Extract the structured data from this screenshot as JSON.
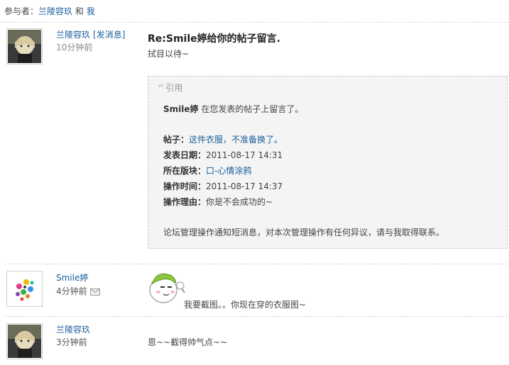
{
  "participants": {
    "label": "参与者：",
    "user1": "兰陵容玖",
    "conj": "和",
    "user2": "我"
  },
  "messages": [
    {
      "author": "兰陵容玖",
      "pm_link": "[发消息]",
      "time": "10分钟前",
      "subject": "Re:Smile婷给你的帖子留言.",
      "body": "拭目以待~",
      "quote": {
        "header": "引用",
        "intro_name": "Smile婷",
        "intro_text": "在您发表的帖子上留言了。",
        "post_label": "帖子：",
        "post_link": "这件衣服，不准备换了。",
        "date_label": "发表日期：",
        "date_value": "2011-08-17 14:31",
        "board_label": "所在版块：",
        "board_link": "口-心情涂鸦",
        "optime_label": "操作时间：",
        "optime_value": "2011-08-17 14:37",
        "reason_label": "操作理由：",
        "reason_value": "你是不会成功的~",
        "notice": "论坛管理操作通知短消息，对本次管理操作有任何异议，请与我取得联系。"
      }
    },
    {
      "author": "Smile婷",
      "time": "4分钟前",
      "body": "我要截图。。你现在穿的衣服图~",
      "icon": "envelope-icon"
    },
    {
      "author": "兰陵容玖",
      "time": "3分钟前",
      "body": "恩~~截得帅气点~~"
    }
  ],
  "colors": {
    "link": "#1a5d9c",
    "quote_bg": "#f4f4f4"
  }
}
